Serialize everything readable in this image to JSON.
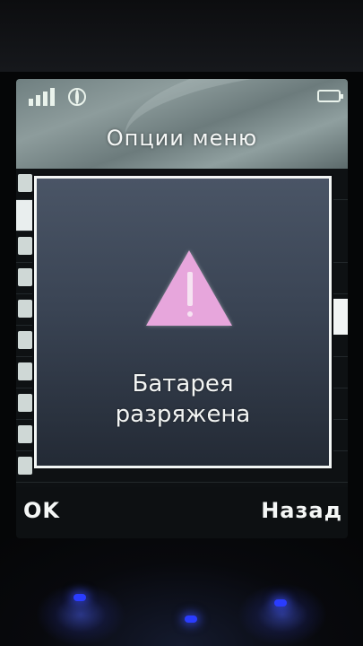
{
  "status_bar": {
    "signal_icon": "signal-bars-icon",
    "network_icon": "globe-icon",
    "battery_icon": "battery-icon"
  },
  "menu": {
    "title": "Опции меню"
  },
  "dialog": {
    "icon": "warning-triangle-icon",
    "icon_color": "#e7a6dc",
    "message_line1": "Батарея",
    "message_line2": "разряжена"
  },
  "softkeys": {
    "left_label": "OK",
    "right_label": "Назад"
  }
}
